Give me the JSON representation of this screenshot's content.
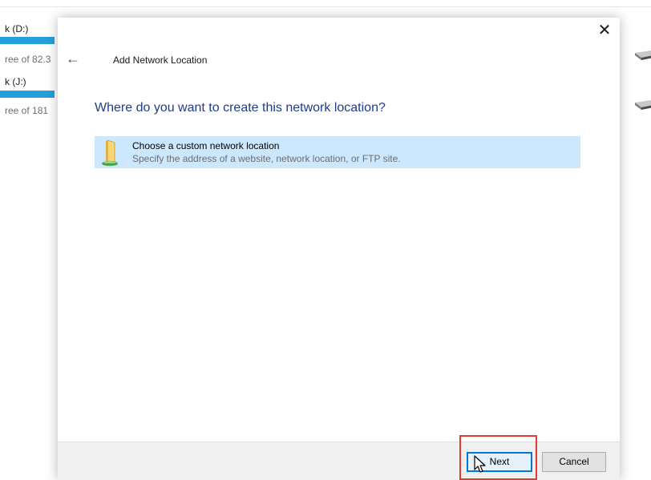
{
  "background": {
    "drives": [
      {
        "label": "k (D:)",
        "free_text": "ree of 82.3"
      },
      {
        "label": "k (J:)",
        "free_text": "ree of 181"
      }
    ]
  },
  "dialog": {
    "title": "Add Network Location",
    "close_glyph": "✕",
    "back_glyph": "←",
    "heading": "Where do you want to create this network location?",
    "option": {
      "title": "Choose a custom network location",
      "description": "Specify the address of a website, network location, or FTP site.",
      "icon": "folder-network-icon"
    },
    "buttons": {
      "next": "Next",
      "cancel": "Cancel"
    }
  },
  "colors": {
    "heading": "#1f3c8a",
    "selection": "#cce8ff",
    "drive_bar": "#26a0da",
    "highlight": "#e53935"
  }
}
